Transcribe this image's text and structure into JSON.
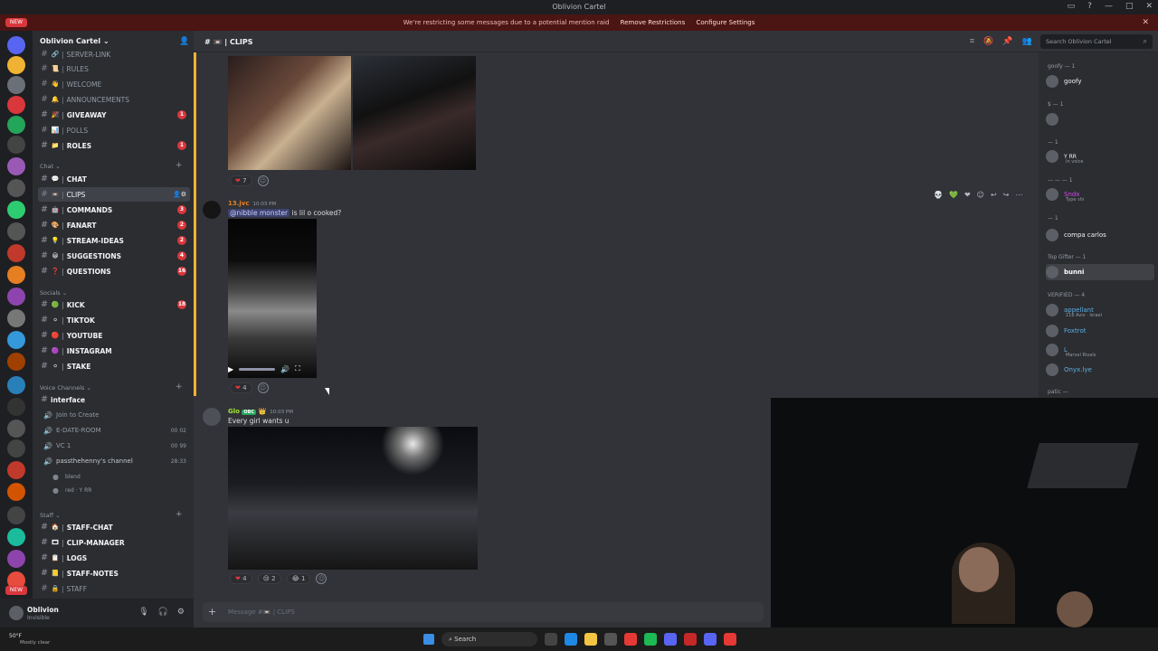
{
  "window": {
    "title": "Oblivion Cartel"
  },
  "notice": {
    "text": "We're restricting some messages due to a potential mention raid",
    "remove_label": "Remove Restrictions",
    "configure_label": "Configure Settings"
  },
  "guild_bar": {
    "new_badge": "NEW",
    "new_badge_bottom": "NEW"
  },
  "server": {
    "name": "Oblivion Cartel"
  },
  "channels": {
    "top": [
      {
        "name": "SERVER-LINK",
        "emoji": "🔗"
      },
      {
        "name": "RULES",
        "emoji": "📜"
      },
      {
        "name": "WELCOME",
        "emoji": "👋"
      },
      {
        "name": "ANNOUNCEMENTS",
        "emoji": "🔔"
      },
      {
        "name": "GIVEAWAY",
        "emoji": "🎉",
        "badge": "1"
      },
      {
        "name": "POLLS",
        "emoji": "📊"
      },
      {
        "name": "ROLES",
        "emoji": "📁",
        "badge": "1"
      }
    ],
    "chat_category": "Chat",
    "chat": [
      {
        "name": "CHAT",
        "emoji": "💬"
      },
      {
        "name": "CLIPS",
        "emoji": "📼"
      },
      {
        "name": "COMMANDS",
        "emoji": "🤖",
        "badge": "3"
      },
      {
        "name": "FANART",
        "emoji": "🎨",
        "badge": "2"
      },
      {
        "name": "STREAM-IDEAS",
        "emoji": "💡",
        "badge": "2"
      },
      {
        "name": "SUGGESTIONS",
        "emoji": "😀",
        "badge": "4"
      },
      {
        "name": "QUESTIONS",
        "emoji": "❓",
        "badge": "16"
      }
    ],
    "socials_category": "Socials",
    "socials": [
      {
        "name": "KICK",
        "emoji": "🟢",
        "badge": "18"
      },
      {
        "name": "TIKTOK",
        "emoji": "⚪"
      },
      {
        "name": "YOUTUBE",
        "emoji": "🔴"
      },
      {
        "name": "INSTAGRAM",
        "emoji": "🟣"
      },
      {
        "name": "STAKE",
        "emoji": "⚪"
      }
    ],
    "voice_category": "Voice Channels",
    "voice_text": "interface",
    "voice": [
      {
        "name": "Join to Create",
        "count": ""
      },
      {
        "name": "E-DATE-ROOM",
        "count": "00 02"
      },
      {
        "name": "VC 1",
        "count": "00 99"
      },
      {
        "name": "passthehenny's channel",
        "count": "28:33"
      }
    ],
    "voice_users": [
      "blend",
      "red · Y RR"
    ],
    "staff_category": "Staff",
    "staff": [
      {
        "name": "STAFF-CHAT",
        "emoji": "🏠"
      },
      {
        "name": "CLIP-MANAGER",
        "emoji": "🎞"
      },
      {
        "name": "LOGS",
        "emoji": "📋"
      },
      {
        "name": "STAFF-NOTES",
        "emoji": "📒"
      },
      {
        "name": "STAFF",
        "emoji": "🔒"
      }
    ]
  },
  "user_panel": {
    "name": "Oblivion",
    "status": "Invisible"
  },
  "header": {
    "channel": "| CLIPS",
    "search_placeholder": "Search Oblivion Cartel"
  },
  "messages": [
    {
      "reactions": [
        {
          "emoji": "❤",
          "count": "7"
        }
      ]
    },
    {
      "author": "13.jvc",
      "time": "10:03 PM",
      "mention": "@nibble monster",
      "text": "is lil o cooked?",
      "reactions": [
        {
          "emoji": "❤",
          "count": "4"
        }
      ]
    },
    {
      "author": "Glo",
      "tag": "OBC",
      "time": "10:03 PM",
      "text": "Every girl wants u",
      "reactions": [
        {
          "emoji": "❤",
          "count": "4"
        },
        {
          "emoji": "😢",
          "count": "2"
        },
        {
          "emoji": "😂",
          "count": "1"
        }
      ]
    }
  ],
  "composer": {
    "placeholder": "Message #📼 | CLIPS"
  },
  "members": {
    "groups": [
      {
        "label": "goofy — 1",
        "users": [
          {
            "name": "goofy",
            "sub": ""
          }
        ]
      },
      {
        "label": "$ — 1",
        "users": [
          {
            "name": "",
            "sub": ""
          }
        ]
      },
      {
        "label": "— 1",
        "users": [
          {
            "name": "Y RR",
            "sub": "In voice"
          }
        ]
      },
      {
        "label": "— — — 1",
        "users": [
          {
            "name": "Sndx",
            "sub": "Type shi"
          }
        ]
      },
      {
        "label": "— 1",
        "users": [
          {
            "name": "compa carlos",
            "sub": ""
          }
        ]
      },
      {
        "label": "Top Gifter — 1",
        "users": [
          {
            "name": "bunni",
            "sub": ""
          }
        ]
      },
      {
        "label": "VERIFIED — 4",
        "users": [
          {
            "name": "appellant",
            "sub": "116 Aviv · Israel"
          },
          {
            "name": "Foxtrot",
            "sub": ""
          },
          {
            "name": "L",
            "sub": "Marvel Rivals"
          },
          {
            "name": "Onyx.lye",
            "sub": ""
          }
        ]
      },
      {
        "label": "patic — ",
        "users": []
      }
    ]
  },
  "taskbar": {
    "weather_temp": "50°F",
    "weather_desc": "Mostly clear",
    "search_label": "Search"
  }
}
